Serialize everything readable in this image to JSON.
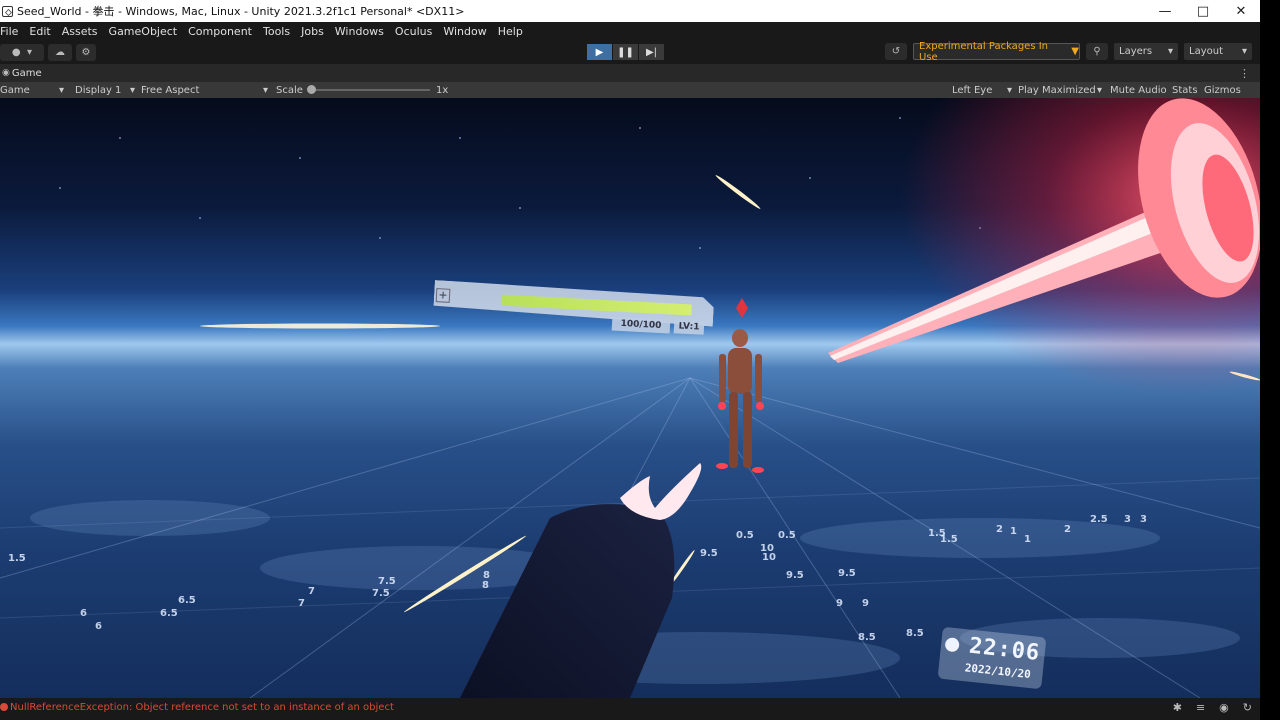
{
  "window": {
    "title": "Seed_World - 拳击 - Windows, Mac, Linux - Unity 2021.3.2f1c1 Personal* <DX11>"
  },
  "menu": [
    "File",
    "Edit",
    "Assets",
    "GameObject",
    "Component",
    "Tools",
    "Jobs",
    "Windows",
    "Oculus",
    "Window",
    "Help"
  ],
  "toolbar": {
    "account_label": "",
    "experimental_label": "Experimental Packages In Use",
    "layers_label": "Layers",
    "layout_label": "Layout"
  },
  "game_tab": {
    "label": "Game"
  },
  "game_toolbar": {
    "view_select": "Game",
    "display": "Display 1",
    "aspect": "Free Aspect",
    "scale_label": "Scale",
    "scale_value": "1x",
    "eye": "Left Eye",
    "play_mode": "Play Maximized",
    "mute": "Mute Audio",
    "stats": "Stats",
    "gizmos": "Gizmos"
  },
  "hud": {
    "hp_fraction": 0.95,
    "hp_text": "100/100",
    "level_text": "LV:1",
    "clock_time": "22:06",
    "clock_date": "2022/10/20"
  },
  "grid_numbers": [
    "1.5",
    "6",
    "6",
    "6.5",
    "6.5",
    "7",
    "7",
    "7.5",
    "7.5",
    "8",
    "8",
    "8.5",
    "8.5",
    "9",
    "9",
    "9.5",
    "9.5",
    "9.5",
    "10",
    "10",
    "0.5",
    "0.5",
    "1",
    "1",
    "1.5",
    "1.5",
    "2",
    "2",
    "2.5",
    "3",
    "3"
  ],
  "status": {
    "message": "NullReferenceException: Object reference not set to an instance of an object"
  },
  "colors": {
    "accent_play": "#3d6fa3",
    "warning_orange": "#f0a820",
    "error_red": "#d94a3a",
    "hp_green": "#c4e862",
    "laser_red": "#ff3d4d"
  }
}
